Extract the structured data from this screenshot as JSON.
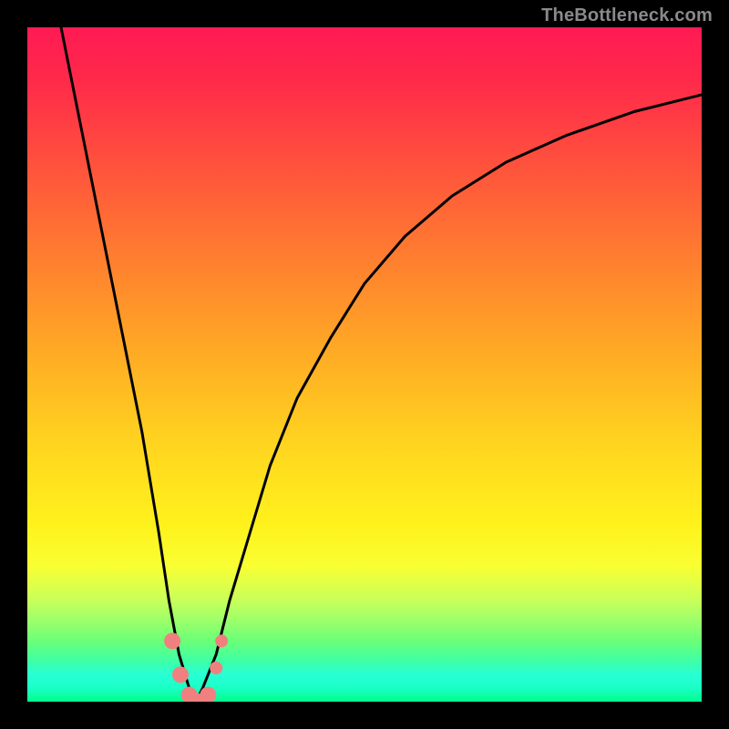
{
  "watermark": {
    "text": "TheBottleneck.com"
  },
  "chart_data": {
    "type": "line",
    "title": "",
    "xlabel": "",
    "ylabel": "",
    "xlim": [
      0,
      100
    ],
    "ylim": [
      0,
      100
    ],
    "grid": false,
    "legend": false,
    "background_gradient": {
      "direction": "vertical",
      "stops": [
        {
          "pos": 0,
          "color": "#ff1a53"
        },
        {
          "pos": 50,
          "color": "#ffb024"
        },
        {
          "pos": 80,
          "color": "#f8ff33"
        },
        {
          "pos": 100,
          "color": "#00ff8a"
        }
      ]
    },
    "series": [
      {
        "name": "bottleneck-curve",
        "color": "#000000",
        "x": [
          5,
          8,
          11,
          14,
          17,
          19.5,
          21,
          22.5,
          24,
          25,
          26,
          28,
          30,
          33,
          36,
          40,
          45,
          50,
          56,
          63,
          71,
          80,
          90,
          100
        ],
        "y": [
          100,
          85,
          70,
          55,
          40,
          25,
          15,
          7,
          2,
          0,
          2,
          7,
          15,
          25,
          35,
          45,
          54,
          62,
          69,
          75,
          80,
          84,
          87.5,
          90
        ]
      }
    ],
    "markers": [
      {
        "x": 21.5,
        "y": 9,
        "r": 9,
        "color": "#f08080"
      },
      {
        "x": 22.7,
        "y": 4,
        "r": 9,
        "color": "#f08080"
      },
      {
        "x": 24.0,
        "y": 1,
        "r": 9,
        "color": "#f08080"
      },
      {
        "x": 25.3,
        "y": 0,
        "r": 9,
        "color": "#f08080"
      },
      {
        "x": 26.8,
        "y": 1,
        "r": 9,
        "color": "#f08080"
      },
      {
        "x": 28.0,
        "y": 5,
        "r": 7,
        "color": "#f08080"
      },
      {
        "x": 28.8,
        "y": 9,
        "r": 7,
        "color": "#f08080"
      }
    ]
  }
}
